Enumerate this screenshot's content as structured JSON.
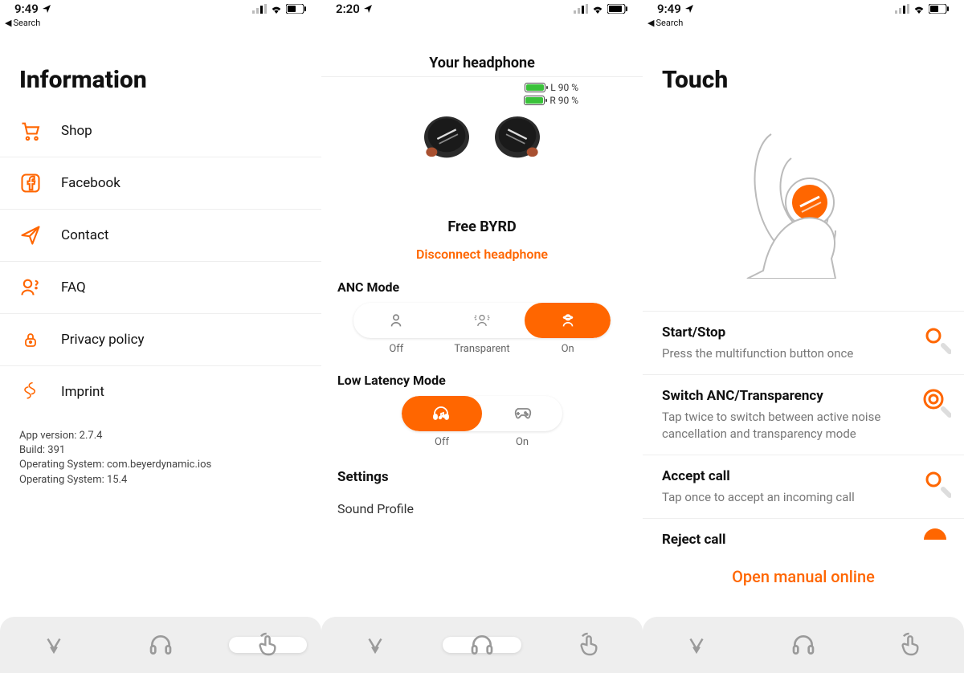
{
  "status": {
    "time_a": "9:49",
    "time_b": "2:20",
    "back_label": "Search"
  },
  "information": {
    "title": "Information",
    "items": [
      {
        "label": "Shop"
      },
      {
        "label": "Facebook"
      },
      {
        "label": "Contact"
      },
      {
        "label": "FAQ"
      },
      {
        "label": "Privacy policy"
      },
      {
        "label": "Imprint"
      }
    ],
    "meta": {
      "line1": "App version: 2.7.4",
      "line2": "Build: 391",
      "line3": "Operating System: com.beyerdynamic.ios",
      "line4": "Operating System: 15.4"
    }
  },
  "headphone": {
    "title": "Your headphone",
    "battery": {
      "left_label": "L 90 %",
      "right_label": "R 90 %",
      "left_pct": 90,
      "right_pct": 90
    },
    "device_name": "Free BYRD",
    "disconnect_label": "Disconnect headphone",
    "anc": {
      "section": "ANC Mode",
      "options": [
        "Off",
        "Transparent",
        "On"
      ],
      "active_index": 2
    },
    "low_latency": {
      "section": "Low Latency Mode",
      "options": [
        "Off",
        "On"
      ],
      "active_index": 0
    },
    "settings": {
      "header": "Settings",
      "row1": "Sound Profile"
    }
  },
  "touch": {
    "title": "Touch",
    "items": [
      {
        "title": "Start/Stop",
        "desc": "Press the multifunction button once"
      },
      {
        "title": "Switch ANC/Transparency",
        "desc": "Tap twice to switch between active noise cancellation and transparency mode"
      },
      {
        "title": "Accept call",
        "desc": "Tap once to accept an incoming call"
      },
      {
        "title": "Reject call",
        "desc": ""
      }
    ],
    "manual_link": "Open manual online"
  },
  "tabs": {
    "items": [
      "brand",
      "headphones",
      "touch"
    ]
  }
}
